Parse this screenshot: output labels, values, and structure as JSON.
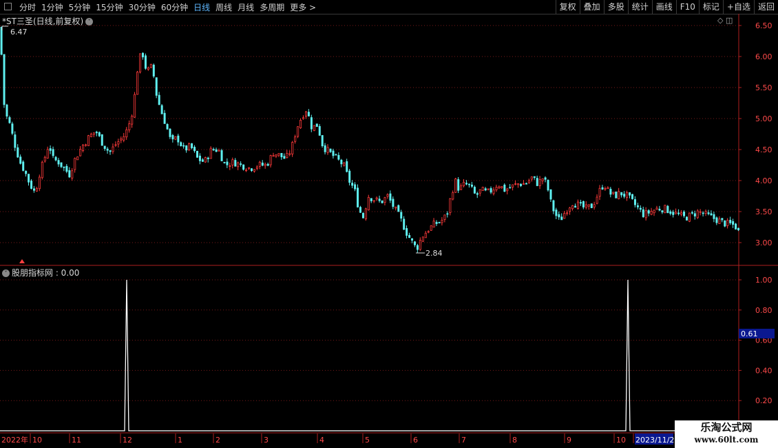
{
  "toolbar": {
    "tabs": [
      "分时",
      "1分钟",
      "5分钟",
      "15分钟",
      "30分钟",
      "60分钟",
      "日线",
      "周线",
      "月线",
      "多周期",
      "更多 >"
    ],
    "active_tab": "日线",
    "right_buttons": [
      "复权",
      "叠加",
      "多股",
      "统计",
      "画线",
      "F10",
      "标记",
      "+自选",
      "返回"
    ]
  },
  "main_chart": {
    "title": "*ST三圣(日线,前复权)",
    "high_label": "6.47",
    "low_label": "2.84"
  },
  "indicator": {
    "title": "股朋指标网 : 0.00",
    "current_value_tag": "0.61"
  },
  "watermark": {
    "line1": "乐淘公式网",
    "line2": "www.60lt.com"
  },
  "colors": {
    "up": "#ff3a3a",
    "down": "#5ff0f0",
    "grid": "#7a1a1a",
    "axis_text": "#ff4a4a",
    "border": "#b02020",
    "indicator_line": "#ffffff",
    "value_tag_bg": "#0a1890"
  },
  "chart_data": [
    {
      "type": "candlestick",
      "title": "*ST三圣(日线,前复权)",
      "ylim": [
        2.75,
        6.6
      ],
      "yticks": [
        "6.50",
        "6.00",
        "5.50",
        "5.00",
        "4.50",
        "4.00",
        "3.50",
        "3.00"
      ],
      "x_ticks": [
        "2022年",
        "10",
        "11",
        "12",
        "1",
        "2",
        "3",
        "4",
        "5",
        "6",
        "7",
        "8",
        "9",
        "10",
        "2023/11/2"
      ],
      "path": [
        [
          0,
          6.47
        ],
        [
          2,
          5.6
        ],
        [
          6,
          5.1
        ],
        [
          12,
          4.95
        ],
        [
          20,
          4.6
        ],
        [
          28,
          4.3
        ],
        [
          35,
          4.15
        ],
        [
          42,
          3.95
        ],
        [
          50,
          3.8
        ],
        [
          56,
          4.1
        ],
        [
          62,
          4.3
        ],
        [
          70,
          4.6
        ],
        [
          76,
          4.35
        ],
        [
          84,
          4.3
        ],
        [
          92,
          4.2
        ],
        [
          100,
          4.1
        ],
        [
          108,
          4.35
        ],
        [
          118,
          4.55
        ],
        [
          128,
          4.7
        ],
        [
          138,
          4.8
        ],
        [
          148,
          4.6
        ],
        [
          158,
          4.45
        ],
        [
          168,
          4.6
        ],
        [
          178,
          4.7
        ],
        [
          185,
          4.85
        ],
        [
          190,
          5.05
        ],
        [
          195,
          5.4
        ],
        [
          200,
          5.95
        ],
        [
          206,
          6.05
        ],
        [
          212,
          5.75
        ],
        [
          220,
          5.85
        ],
        [
          226,
          5.4
        ],
        [
          232,
          5.15
        ],
        [
          240,
          4.9
        ],
        [
          248,
          4.6
        ],
        [
          256,
          4.7
        ],
        [
          266,
          4.5
        ],
        [
          276,
          4.55
        ],
        [
          286,
          4.35
        ],
        [
          296,
          4.3
        ],
        [
          306,
          4.5
        ],
        [
          316,
          4.5
        ],
        [
          326,
          4.25
        ],
        [
          338,
          4.3
        ],
        [
          350,
          4.25
        ],
        [
          362,
          4.2
        ],
        [
          374,
          4.25
        ],
        [
          386,
          4.25
        ],
        [
          396,
          4.45
        ],
        [
          406,
          4.4
        ],
        [
          414,
          4.35
        ],
        [
          422,
          4.5
        ],
        [
          430,
          4.85
        ],
        [
          438,
          5.05
        ],
        [
          444,
          5.15
        ],
        [
          452,
          4.85
        ],
        [
          460,
          4.9
        ],
        [
          468,
          4.55
        ],
        [
          478,
          4.45
        ],
        [
          488,
          4.35
        ],
        [
          498,
          4.25
        ],
        [
          506,
          4.0
        ],
        [
          514,
          3.85
        ],
        [
          520,
          3.55
        ],
        [
          526,
          3.4
        ],
        [
          534,
          3.75
        ],
        [
          542,
          3.7
        ],
        [
          552,
          3.65
        ],
        [
          562,
          3.75
        ],
        [
          572,
          3.55
        ],
        [
          580,
          3.4
        ],
        [
          590,
          3.15
        ],
        [
          598,
          3.0
        ],
        [
          604,
          2.9
        ],
        [
          612,
          3.1
        ],
        [
          620,
          3.2
        ],
        [
          630,
          3.3
        ],
        [
          640,
          3.35
        ],
        [
          648,
          3.45
        ],
        [
          654,
          3.75
        ],
        [
          660,
          4.0
        ],
        [
          666,
          3.85
        ],
        [
          674,
          3.95
        ],
        [
          682,
          3.9
        ],
        [
          690,
          3.75
        ],
        [
          698,
          3.85
        ],
        [
          706,
          3.8
        ],
        [
          714,
          3.85
        ],
        [
          722,
          3.95
        ],
        [
          732,
          3.85
        ],
        [
          742,
          3.9
        ],
        [
          752,
          3.95
        ],
        [
          762,
          3.95
        ],
        [
          772,
          4.05
        ],
        [
          780,
          3.95
        ],
        [
          788,
          4.05
        ],
        [
          794,
          3.9
        ],
        [
          800,
          3.6
        ],
        [
          806,
          3.45
        ],
        [
          812,
          3.35
        ],
        [
          820,
          3.5
        ],
        [
          830,
          3.65
        ],
        [
          840,
          3.6
        ],
        [
          850,
          3.55
        ],
        [
          860,
          3.6
        ],
        [
          868,
          3.8
        ],
        [
          876,
          3.95
        ],
        [
          884,
          3.8
        ],
        [
          892,
          3.75
        ],
        [
          900,
          3.8
        ],
        [
          910,
          3.75
        ],
        [
          918,
          3.65
        ],
        [
          926,
          3.55
        ],
        [
          934,
          3.45
        ],
        [
          944,
          3.5
        ],
        [
          954,
          3.55
        ],
        [
          964,
          3.55
        ],
        [
          974,
          3.5
        ],
        [
          984,
          3.45
        ],
        [
          994,
          3.4
        ],
        [
          1004,
          3.45
        ],
        [
          1014,
          3.5
        ],
        [
          1024,
          3.45
        ],
        [
          1034,
          3.4
        ],
        [
          1044,
          3.35
        ],
        [
          1054,
          3.3
        ],
        [
          1062,
          3.3
        ],
        [
          1068,
          3.25
        ],
        [
          1073,
          3.15
        ]
      ]
    },
    {
      "type": "line",
      "title": "股朋指标网",
      "ylim": [
        0,
        1.05
      ],
      "yticks": [
        "1.00",
        "0.80",
        "0.60",
        "0.40",
        "0.20"
      ],
      "signal_x": [
        184,
        912
      ],
      "signal_value": 1.0,
      "baseline": 0.0
    }
  ]
}
